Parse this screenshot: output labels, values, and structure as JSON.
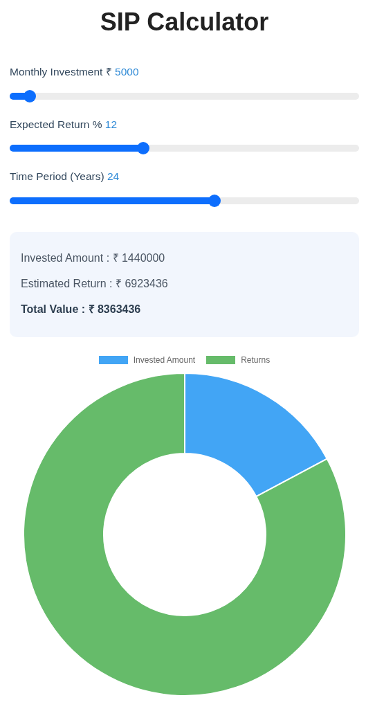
{
  "title": "SIP Calculator",
  "inputs": [
    {
      "label": "Monthly Investment ₹",
      "value": "5000",
      "level": 0.058
    },
    {
      "label": "Expected Return %",
      "value": "12",
      "level": 0.383
    },
    {
      "label": "Time Period (Years)",
      "value": "24",
      "level": 0.587
    }
  ],
  "summary": [
    {
      "text": "Invested Amount : ₹ 1440000",
      "kind": "normal"
    },
    {
      "text": "Estimated Return : ₹ 6923436",
      "kind": "normal"
    },
    {
      "text": "Total Value : ₹ 8363436",
      "kind": "total"
    }
  ],
  "chart_data": {
    "type": "donut",
    "categories": [
      "Invested Amount",
      "Returns"
    ],
    "values": [
      17.22,
      82.78
    ],
    "colors": [
      "#42a5f5",
      "#66bb6a"
    ]
  }
}
